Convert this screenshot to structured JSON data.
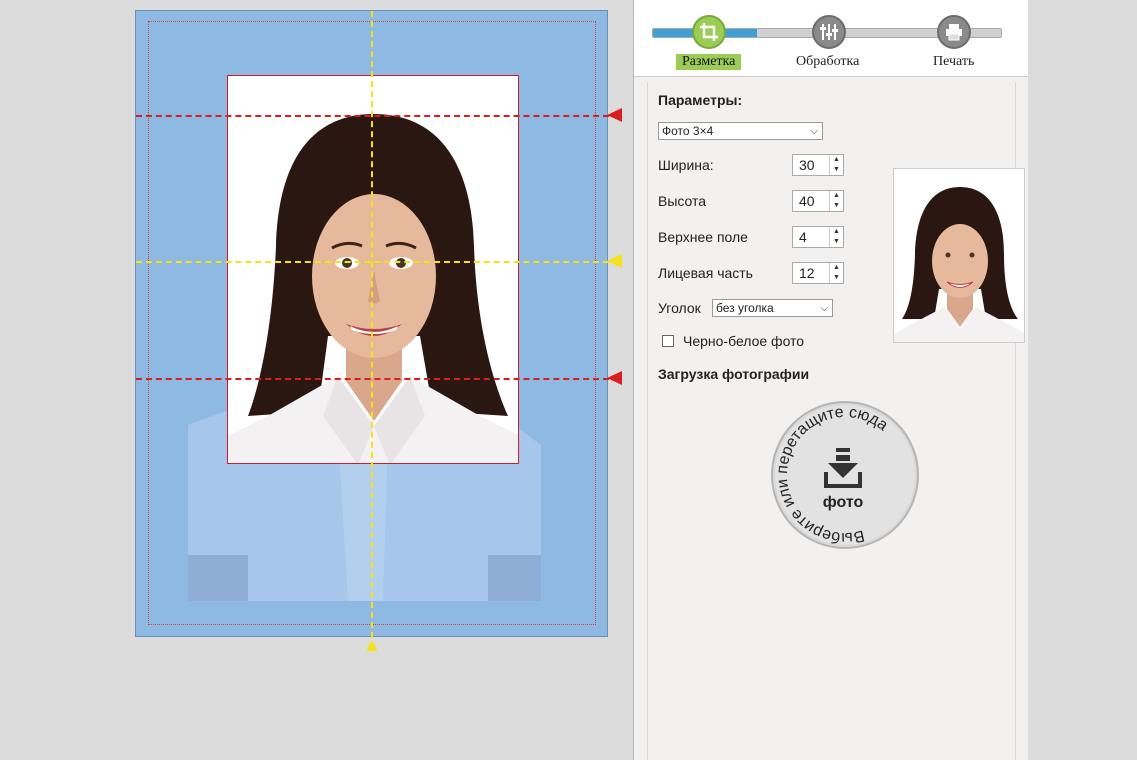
{
  "steps": [
    {
      "label": "Разметка",
      "active": true
    },
    {
      "label": "Обработка",
      "active": false
    },
    {
      "label": "Печать",
      "active": false
    }
  ],
  "params": {
    "title": "Параметры:",
    "format": "Фото 3×4",
    "width_label": "Ширина:",
    "width_value": "30",
    "height_label": "Высота",
    "height_value": "40",
    "top_margin_label": "Верхнее поле",
    "top_margin_value": "4",
    "face_label": "Лицевая часть",
    "face_value": "12",
    "corner_label": "Уголок",
    "corner_value": "без уголка",
    "bw_label": "Черно-белое фото",
    "upload_title": "Загрузка фотографии"
  },
  "upload": {
    "arc_text": "Выберите или перетащите сюда",
    "center_text": "фото"
  },
  "colors": {
    "canvas_bg": "#8db9e2",
    "guide_red": "#d81e1e",
    "guide_yellow": "#f5e21a",
    "active_step": "#9bcc55",
    "progress": "#3fa0d6"
  }
}
